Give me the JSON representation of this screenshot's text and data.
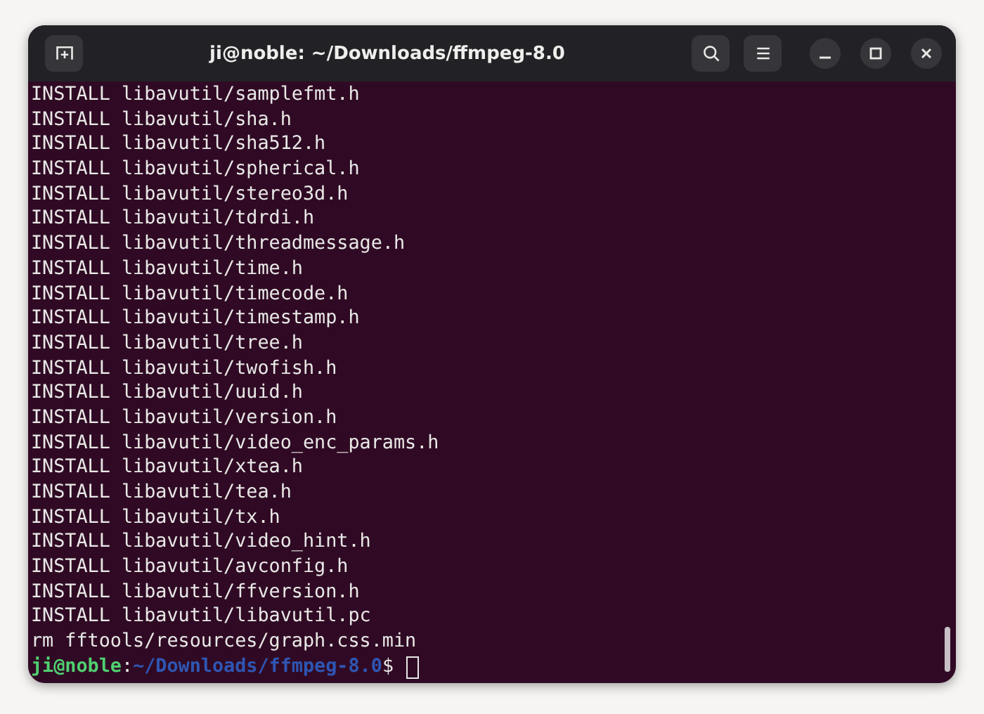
{
  "window": {
    "title": "ji@noble: ~/Downloads/ffmpeg-8.0"
  },
  "lines": [
    "INSTALL libavutil/samplefmt.h",
    "INSTALL libavutil/sha.h",
    "INSTALL libavutil/sha512.h",
    "INSTALL libavutil/spherical.h",
    "INSTALL libavutil/stereo3d.h",
    "INSTALL libavutil/tdrdi.h",
    "INSTALL libavutil/threadmessage.h",
    "INSTALL libavutil/time.h",
    "INSTALL libavutil/timecode.h",
    "INSTALL libavutil/timestamp.h",
    "INSTALL libavutil/tree.h",
    "INSTALL libavutil/twofish.h",
    "INSTALL libavutil/uuid.h",
    "INSTALL libavutil/version.h",
    "INSTALL libavutil/video_enc_params.h",
    "INSTALL libavutil/xtea.h",
    "INSTALL libavutil/tea.h",
    "INSTALL libavutil/tx.h",
    "INSTALL libavutil/video_hint.h",
    "INSTALL libavutil/avconfig.h",
    "INSTALL libavutil/ffversion.h",
    "INSTALL libavutil/libavutil.pc",
    "rm fftools/resources/graph.css.min"
  ],
  "prompt": {
    "user": "ji@noble",
    "separator": ":",
    "path": "~/Downloads/ffmpeg-8.0",
    "symbol": "$"
  }
}
